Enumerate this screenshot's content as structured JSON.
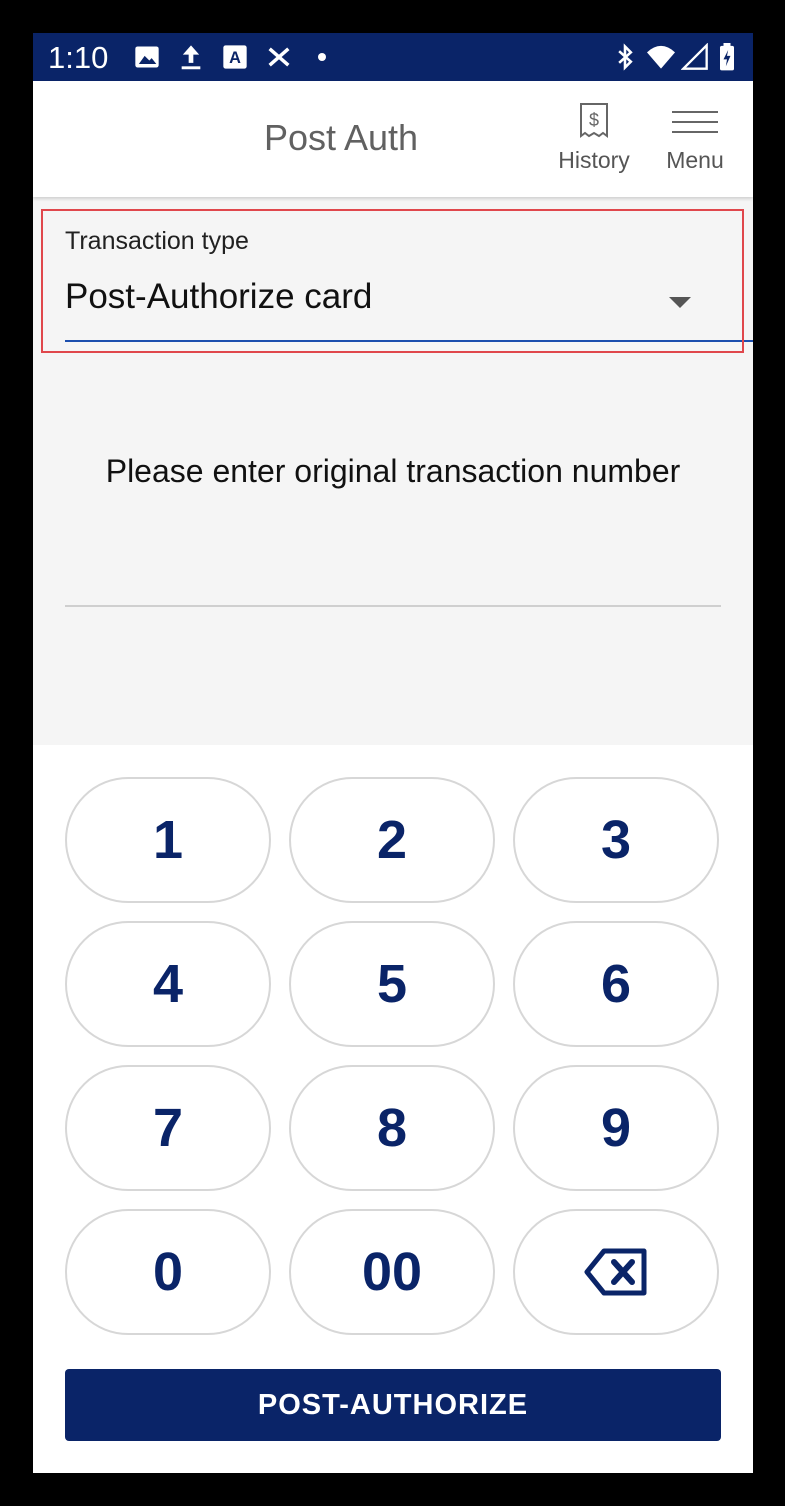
{
  "status_bar": {
    "time": "1:10",
    "left_icons": [
      "image-icon",
      "upload-icon",
      "text-icon",
      "no-service-icon"
    ],
    "right_icons": [
      "bluetooth-icon",
      "wifi-icon",
      "signal-icon",
      "battery-charging-icon"
    ]
  },
  "app_bar": {
    "title": "Post Auth",
    "history_label": "History",
    "history_icon": "receipt-dollar-icon",
    "menu_label": "Menu",
    "menu_icon": "hamburger-menu-icon"
  },
  "transaction_type": {
    "label": "Transaction type",
    "selected": "Post-Authorize card"
  },
  "prompt": "Please enter original transaction number",
  "transaction_number_value": "",
  "keypad": {
    "keys": [
      "1",
      "2",
      "3",
      "4",
      "5",
      "6",
      "7",
      "8",
      "9",
      "0",
      "00"
    ],
    "backspace_icon": "backspace-icon"
  },
  "submit_label": "POST-AUTHORIZE",
  "colors": {
    "primary": "#0a2468",
    "highlight": "#e0474c",
    "underline": "#1c4fae"
  }
}
